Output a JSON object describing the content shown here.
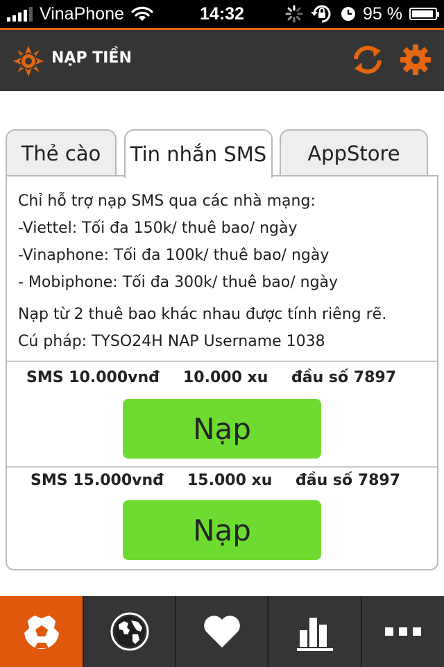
{
  "status_bar": {
    "carrier": "VinaPhone",
    "time": "14:32",
    "battery_text": "95 %",
    "battery_level": 0.95
  },
  "header": {
    "title": "NẠP TIỀN",
    "icons": [
      "app-logo-icon",
      "refresh-icon",
      "settings-gear-icon"
    ]
  },
  "tabs": [
    {
      "label": "Thẻ cào",
      "active": false
    },
    {
      "label": "Tin nhắn SMS",
      "active": true
    },
    {
      "label": "AppStore",
      "active": false
    }
  ],
  "info": {
    "lines": [
      "Chỉ hỗ trợ nạp SMS qua các nhà mạng:",
      "-Viettel: Tối đa 150k/ thuê bao/ ngày",
      "-Vinaphone: Tối đa 100k/ thuê bao/ ngày",
      "- Mobiphone: Tối đa 300k/ thuê bao/ ngày"
    ],
    "note": "Nạp từ 2 thuê bao khác nhau được tính riêng rẽ.",
    "syntax": "Cú pháp: TYSO24H NAP Username 1038"
  },
  "packages": [
    {
      "price": "SMS 10.000vnđ",
      "amount": "10.000 xu",
      "shortcode": "đầu số 7897",
      "button": "Nạp"
    },
    {
      "price": "SMS 15.000vnđ",
      "amount": "15.000 xu",
      "shortcode": "đầu số 7897",
      "button": "Nạp"
    }
  ],
  "bottom_nav": [
    {
      "icon": "soccer-ball-icon",
      "active": true
    },
    {
      "icon": "globe-icon",
      "active": false
    },
    {
      "icon": "heart-icon",
      "active": false
    },
    {
      "icon": "bar-chart-icon",
      "active": false
    },
    {
      "icon": "more-dots-icon",
      "active": false
    }
  ],
  "colors": {
    "accent": "#e5660f",
    "header_bg": "#353535",
    "button_green": "#6edb30",
    "active_tab_orange": "#e0580b"
  }
}
